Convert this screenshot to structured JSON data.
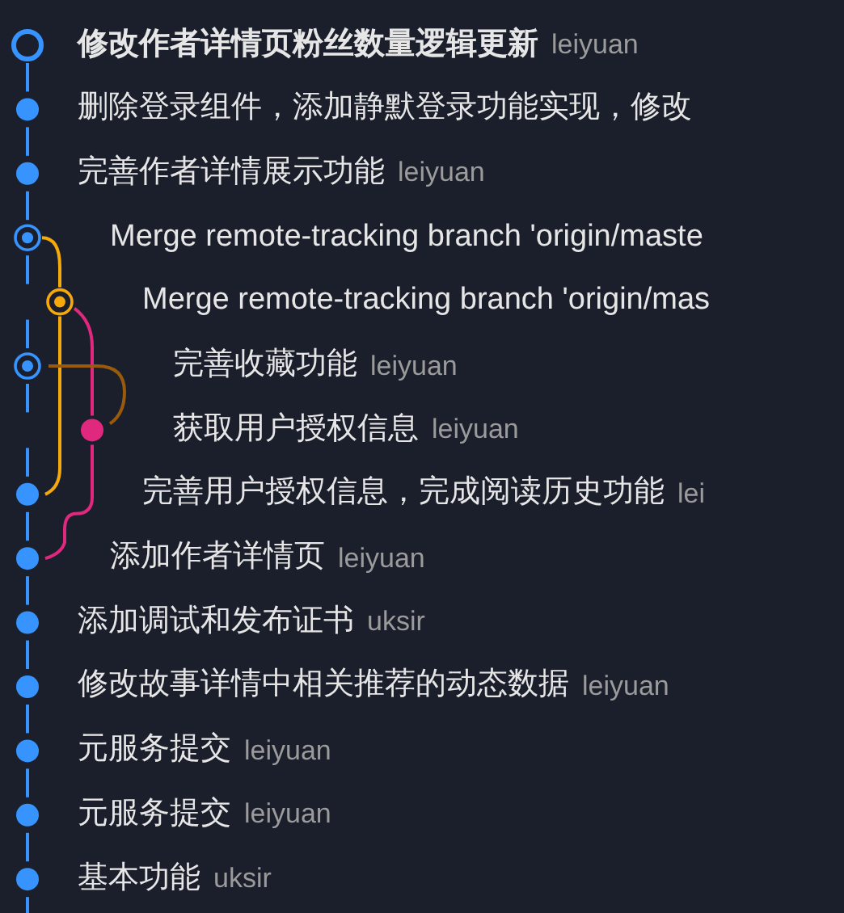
{
  "commits": [
    {
      "message": "修改作者详情页粉丝数量逻辑更新",
      "author": "leiyuan",
      "kind": "head",
      "color": "#3794ff"
    },
    {
      "message": "删除登录组件，添加静默登录功能实现，修改",
      "kind": "commit",
      "color": "#3794ff"
    },
    {
      "message": "完善作者详情展示功能",
      "author": "leiyuan",
      "kind": "commit",
      "color": "#3794ff"
    },
    {
      "message": "Merge remote-tracking branch 'origin/maste",
      "kind": "merge",
      "color": "#3794ff"
    },
    {
      "message": "Merge remote-tracking branch 'origin/mas",
      "kind": "merge",
      "color": "#f5a90a"
    },
    {
      "message": "完善收藏功能",
      "author": "leiyuan",
      "kind": "merge",
      "color": "#3794ff"
    },
    {
      "message": "获取用户授权信息",
      "author": "leiyuan",
      "kind": "commit",
      "color": "#e0287e"
    },
    {
      "message": "完善用户授权信息，完成阅读历史功能",
      "author": "lei",
      "kind": "commit",
      "color": "#3794ff"
    },
    {
      "message": "添加作者详情页",
      "author": "leiyuan",
      "kind": "commit",
      "color": "#3794ff"
    },
    {
      "message": "添加调试和发布证书",
      "author": "uksir",
      "kind": "commit",
      "color": "#3794ff"
    },
    {
      "message": "修改故事详情中相关推荐的动态数据",
      "author": "leiyuan",
      "kind": "commit",
      "color": "#3794ff"
    },
    {
      "message": "元服务提交",
      "author": "leiyuan",
      "kind": "commit",
      "color": "#3794ff"
    },
    {
      "message": "元服务提交",
      "author": "leiyuan",
      "kind": "commit",
      "color": "#3794ff"
    },
    {
      "message": "基本功能",
      "author": "uksir",
      "kind": "commit",
      "color": "#3794ff"
    }
  ]
}
